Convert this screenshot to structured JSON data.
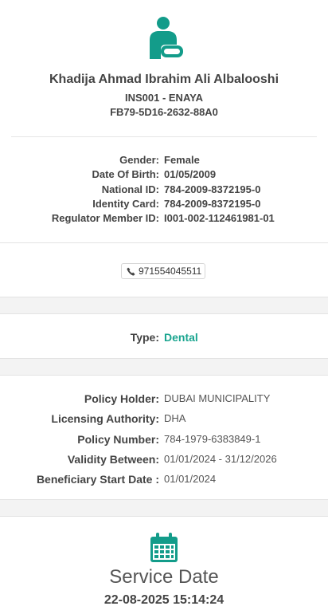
{
  "patient": {
    "name": "Khadija Ahmad Ibrahim Ali Albalooshi",
    "insurance": "INS001 - ENAYA",
    "code": "FB79-5D16-2632-88A0"
  },
  "details": [
    {
      "label": "Gender:",
      "value": "Female"
    },
    {
      "label": "Date Of Birth:",
      "value": "01/05/2009"
    },
    {
      "label": "National ID:",
      "value": "784-2009-8372195-0"
    },
    {
      "label": "Identity Card:",
      "value": "784-2009-8372195-0"
    },
    {
      "label": "Regulator Member ID:",
      "value": "I001-002-112461981-01"
    }
  ],
  "phone": {
    "icon": "phone-icon",
    "number": "971554045511"
  },
  "type": {
    "label": "Type:",
    "value": "Dental"
  },
  "policy": [
    {
      "label": "Policy Holder:",
      "value": "DUBAI MUNICIPALITY"
    },
    {
      "label": "Licensing Authority:",
      "value": "DHA"
    },
    {
      "label": "Policy Number:",
      "value": "784-1979-6383849-1"
    },
    {
      "label": "Validity Between:",
      "value": "01/01/2024 - 31/12/2026"
    },
    {
      "label": "Beneficiary Start Date :",
      "value": "01/01/2024"
    }
  ],
  "service": {
    "title": "Service Date",
    "date": "22-08-2025 15:14:24",
    "icon": "calendar-icon"
  },
  "colors": {
    "accent": "#1aa58f",
    "teal_icon": "#139c8a",
    "band": "#f3f3f3"
  }
}
